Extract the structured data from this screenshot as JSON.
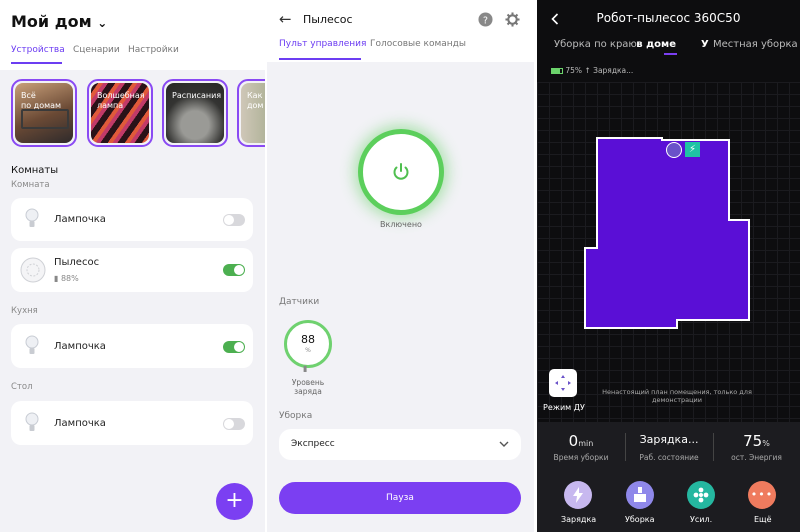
{
  "home": {
    "title": "Мой дом",
    "tabs": [
      "Устройства",
      "Сценарии",
      "Настройки"
    ],
    "stories": [
      {
        "label": "Всё\nпо домам"
      },
      {
        "label": "Волшебная\nлампа"
      },
      {
        "label": "Расписания"
      },
      {
        "label": "Как\nдом"
      }
    ],
    "rooms_title": "Комнаты",
    "groups": [
      {
        "name": "Комната",
        "devices": [
          {
            "name": "Лампочка",
            "on": false
          },
          {
            "name": "Пылесос",
            "battery": "88%",
            "on": true
          }
        ]
      },
      {
        "name": "Кухня",
        "devices": [
          {
            "name": "Лампочка",
            "on": true
          }
        ]
      },
      {
        "name": "Стол",
        "devices": [
          {
            "name": "Лампочка",
            "on": false
          }
        ]
      }
    ],
    "fab": "+"
  },
  "vacuum": {
    "title": "Пылесос",
    "tabs": [
      "Пульт управления",
      "Голосовые команды"
    ],
    "status": "Включено",
    "sensors_title": "Датчики",
    "gauge_value": "88",
    "gauge_unit": "%",
    "gauge_label": "Уровень заряда",
    "mode_title": "Уборка",
    "mode_value": "Экспресс",
    "pause": "Пауза"
  },
  "robot": {
    "title": "Робот-пылесос 360C50",
    "tabs": [
      "Уборка по краю",
      "Уборка в доме",
      "У",
      "Местная уборка"
    ],
    "battery": "75%",
    "charging": "Зарядка...",
    "note": "Ненастоящий план помещения, только для демонстрации",
    "remote": "Режим ДУ",
    "stats": [
      {
        "value": "0",
        "unit": "min",
        "label": "Время уборки"
      },
      {
        "value": "Зарядка...",
        "unit": "",
        "label": "Раб. состояние"
      },
      {
        "value": "75",
        "unit": "%",
        "label": "ост. Энергия"
      }
    ],
    "actions": [
      {
        "label": "Зарядка",
        "color": "#c7b8ef"
      },
      {
        "label": "Уборка",
        "color": "#8f88ea"
      },
      {
        "label": "Усил.",
        "color": "#25b7a0"
      },
      {
        "label": "Ещё",
        "color": "#ef7b5e"
      }
    ],
    "map_color": "#5a0fd6"
  }
}
